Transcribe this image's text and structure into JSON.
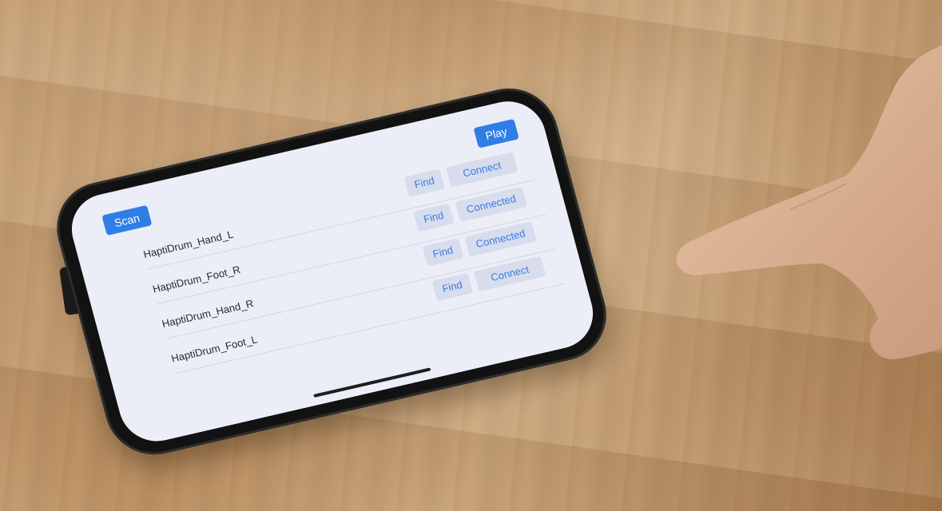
{
  "app": {
    "scan_label": "Scan",
    "play_label": "Play",
    "devices": [
      {
        "name": "HaptiDrum_Hand_L",
        "find_label": "Find",
        "status_label": "Connect"
      },
      {
        "name": "HaptiDrum_Foot_R",
        "find_label": "Find",
        "status_label": "Connected"
      },
      {
        "name": "HaptiDrum_Hand_R",
        "find_label": "Find",
        "status_label": "Connected"
      },
      {
        "name": "HaptiDrum_Foot_L",
        "find_label": "Find",
        "status_label": "Connect"
      }
    ]
  },
  "colors": {
    "accent": "#2f7ee6",
    "secondary_button_bg": "#d7ddec",
    "screen_bg": "#eceef7"
  }
}
